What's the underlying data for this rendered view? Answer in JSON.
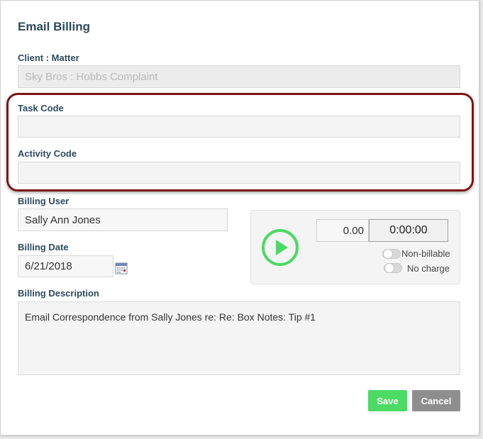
{
  "form": {
    "title": "Email Billing",
    "client_matter": {
      "label": "Client : Matter",
      "value": "Sky Bros : Hobbs Complaint"
    },
    "task_code": {
      "label": "Task Code",
      "value": ""
    },
    "activity_code": {
      "label": "Activity Code",
      "value": ""
    },
    "billing_user": {
      "label": "Billing User",
      "value": "Sally Ann Jones"
    },
    "billing_date": {
      "label": "Billing Date",
      "value": "6/21/2018"
    },
    "billing_description": {
      "label": "Billing Description",
      "value": "Email Correspondence from Sally Jones re: Re: Box Notes: Tip #1"
    }
  },
  "timer": {
    "amount": "0.00",
    "duration": "0:00:00",
    "non_billable_label": "Non-billable",
    "no_charge_label": "No charge",
    "play_icon": "play-circle-icon"
  },
  "buttons": {
    "save_label": "Save",
    "cancel_label": "Cancel"
  },
  "colors": {
    "accent_green": "#4cd964",
    "highlight_red": "#7a1717",
    "label_color": "#2d4a5e",
    "cancel_gray": "#8e8e8e"
  }
}
